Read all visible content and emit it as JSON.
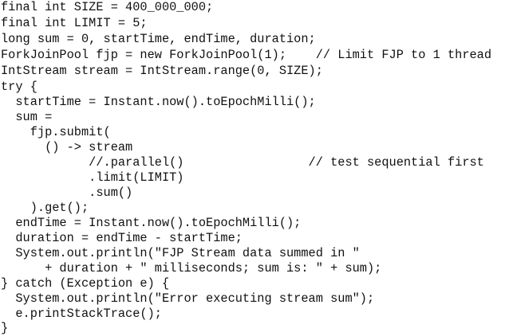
{
  "code": {
    "lines": [
      "final int SIZE = 400_000_000;",
      "final int LIMIT = 5;",
      "long sum = 0, startTime, endTime, duration;",
      "ForkJoinPool fjp = new ForkJoinPool(1);    // Limit FJP to 1 thread",
      "IntStream stream = IntStream.range(0, SIZE);",
      "try {",
      "  startTime = Instant.now().toEpochMilli();",
      "  sum =",
      "    fjp.submit(",
      "      () -> stream",
      "            //.parallel()                 // test sequential first",
      "            .limit(LIMIT)",
      "            .sum()",
      "    ).get();",
      "  endTime = Instant.now().toEpochMilli();",
      "  duration = endTime - startTime;",
      "  System.out.println(\"FJP Stream data summed in \"",
      "      + duration + \" milliseconds; sum is: \" + sum);",
      "} catch (Exception e) {",
      "  System.out.println(\"Error executing stream sum\");",
      "  e.printStackTrace();",
      "}"
    ]
  }
}
